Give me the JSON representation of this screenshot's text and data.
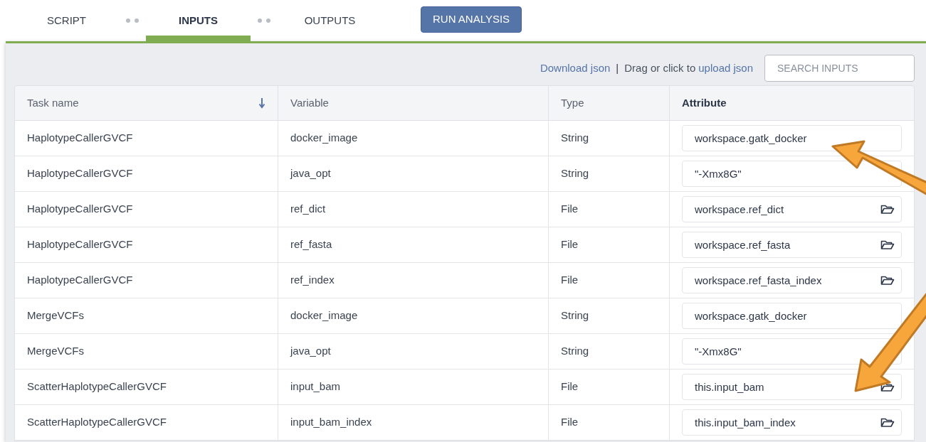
{
  "tabs": [
    {
      "label": "SCRIPT",
      "selected": false
    },
    {
      "label": "INPUTS",
      "selected": true
    },
    {
      "label": "OUTPUTS",
      "selected": false
    }
  ],
  "run_button": "RUN ANALYSIS",
  "toolbar": {
    "download_link": "Download json",
    "separator": "|",
    "upload_prefix": "Drag or click to",
    "upload_link": "upload json",
    "search": {
      "placeholder": "SEARCH INPUTS"
    }
  },
  "table": {
    "columns": [
      {
        "label": "Task name",
        "sorted": true,
        "active": false
      },
      {
        "label": "Variable",
        "sorted": false,
        "active": false
      },
      {
        "label": "Type",
        "sorted": false,
        "active": false
      },
      {
        "label": "Attribute",
        "sorted": false,
        "active": true
      }
    ],
    "rows": [
      {
        "task": "HaplotypeCallerGVCF",
        "variable": "docker_image",
        "type": "String",
        "attribute": "workspace.gatk_docker",
        "browse": false
      },
      {
        "task": "HaplotypeCallerGVCF",
        "variable": "java_opt",
        "type": "String",
        "attribute": "\"-Xmx8G\"",
        "browse": false
      },
      {
        "task": "HaplotypeCallerGVCF",
        "variable": "ref_dict",
        "type": "File",
        "attribute": "workspace.ref_dict",
        "browse": true
      },
      {
        "task": "HaplotypeCallerGVCF",
        "variable": "ref_fasta",
        "type": "File",
        "attribute": "workspace.ref_fasta",
        "browse": true
      },
      {
        "task": "HaplotypeCallerGVCF",
        "variable": "ref_index",
        "type": "File",
        "attribute": "workspace.ref_fasta_index",
        "browse": true
      },
      {
        "task": "MergeVCFs",
        "variable": "docker_image",
        "type": "String",
        "attribute": "workspace.gatk_docker",
        "browse": false
      },
      {
        "task": "MergeVCFs",
        "variable": "java_opt",
        "type": "String",
        "attribute": "\"-Xmx8G\"",
        "browse": false
      },
      {
        "task": "ScatterHaplotypeCallerGVCF",
        "variable": "input_bam",
        "type": "File",
        "attribute": "this.input_bam",
        "browse": true
      },
      {
        "task": "ScatterHaplotypeCallerGVCF",
        "variable": "input_bam_index",
        "type": "File",
        "attribute": "this.input_bam_index",
        "browse": true
      }
    ]
  }
}
